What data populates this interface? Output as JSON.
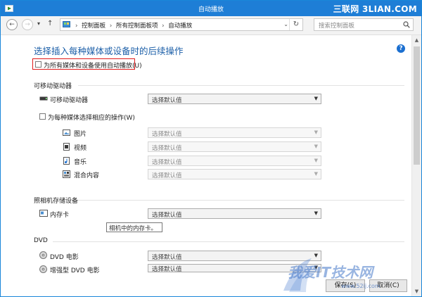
{
  "window": {
    "title": "自动播放",
    "watermark_top": "三联网 3LIAN.COM"
  },
  "nav": {
    "back": "←",
    "forward": "→",
    "history_drop": "▾",
    "up": "↑",
    "breadcrumbs": [
      "控制面板",
      "所有控制面板项",
      "自动播放"
    ],
    "breadcrumb_sep": "›",
    "address_drop": "⌄",
    "refresh": "↻",
    "search_placeholder": "搜索控制面板"
  },
  "page": {
    "heading": "选择插入每种媒体或设备时的后续操作",
    "help": "?",
    "use_autoplay_all": "为所有媒体和设备使用自动播放(U)",
    "removable": {
      "section_title": "可移动驱动器",
      "drive_label": "可移动驱动器",
      "drive_value": "选择默认值",
      "per_media_label": "为每种媒体选择相应的操作(W)",
      "items": [
        {
          "icon": "picture-icon",
          "label": "图片",
          "value": "选择默认值"
        },
        {
          "icon": "video-icon",
          "label": "视频",
          "value": "选择默认值"
        },
        {
          "icon": "music-icon",
          "label": "音乐",
          "value": "选择默认值"
        },
        {
          "icon": "mixed-content-icon",
          "label": "混合内容",
          "value": "选择默认值"
        }
      ]
    },
    "camera": {
      "section_title": "照相机存储设备",
      "card_label": "内存卡",
      "card_value": "选择默认值",
      "tooltip": "相机中的内存卡。"
    },
    "dvd": {
      "section_title": "DVD",
      "movie_label": "DVD 电影",
      "movie_value": "选择默认值",
      "enhanced_label": "增强型 DVD 电影",
      "enhanced_value": "选择默认值"
    },
    "dropdown_arrow": "▼"
  },
  "footer": {
    "save": "保存(S)",
    "cancel": "取消(C)"
  },
  "watermark": {
    "text": "我爱IT技术网",
    "sub": "www.52ij.com"
  },
  "colors": {
    "titlebar": "#1e7ed6",
    "heading": "#1c5fa8",
    "highlight": "#e01a1a"
  }
}
